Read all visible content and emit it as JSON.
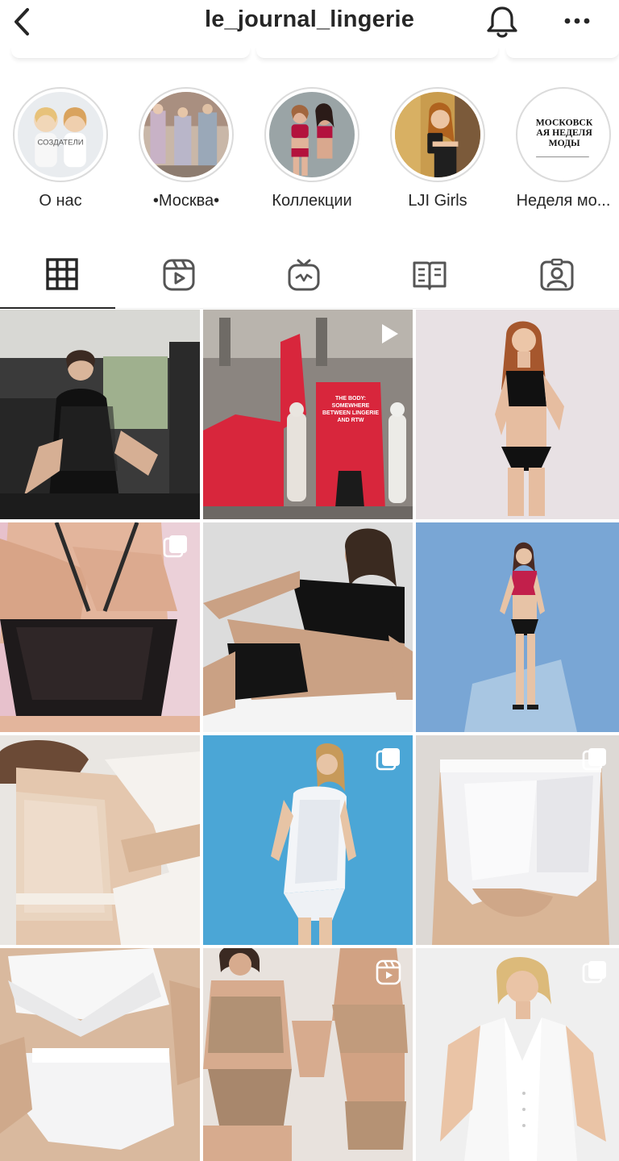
{
  "header": {
    "username": "le_journal_lingerie"
  },
  "highlights": [
    {
      "label": "О нас",
      "cover_text": "СОЗДАТЕЛИ"
    },
    {
      "label": "•Москва•"
    },
    {
      "label": "Коллекции"
    },
    {
      "label": "LJI Girls"
    },
    {
      "label": "Неделя мо...",
      "cover_text": "МОСКОВСКАЯ НЕДЕЛЯ МОДЫ"
    }
  ],
  "tabs": [
    {
      "icon": "grid-icon",
      "active": true
    },
    {
      "icon": "reels-icon",
      "active": false
    },
    {
      "icon": "igtv-icon",
      "active": false
    },
    {
      "icon": "guides-icon",
      "active": false
    },
    {
      "icon": "tagged-icon",
      "active": false
    }
  ],
  "posts": [
    {
      "badge": "none"
    },
    {
      "badge": "video-icon",
      "sign_text": "THE BODY: SOMEWHERE BETWEEN LINGERIE AND RTW"
    },
    {
      "badge": "none"
    },
    {
      "badge": "carousel-icon"
    },
    {
      "badge": "none"
    },
    {
      "badge": "none"
    },
    {
      "badge": "none"
    },
    {
      "badge": "carousel-icon"
    },
    {
      "badge": "carousel-icon"
    },
    {
      "badge": "none"
    },
    {
      "badge": "reels-icon"
    },
    {
      "badge": "carousel-icon"
    }
  ],
  "colors": {
    "text": "#262626",
    "divider": "#efefef",
    "ring": "#dbdbdb",
    "accent_red": "#d8263c"
  }
}
